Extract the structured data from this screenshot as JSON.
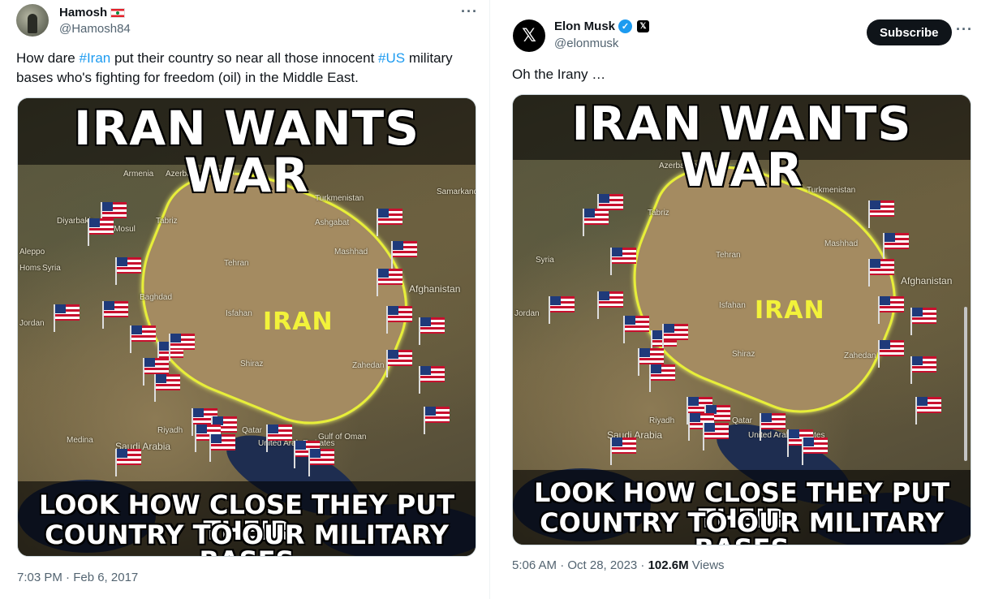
{
  "left_tweet": {
    "display_name": "Hamosh",
    "handle": "@Hamosh84",
    "text_part1": "How dare ",
    "hashtag1": "#Iran",
    "text_part2": " put their country so near all those innocent ",
    "hashtag2": "#US",
    "text_part3": " military bases who's fighting for freedom (oil) in the Middle East.",
    "timestamp": "7:03 PM · Feb 6, 2017",
    "more_label": "···"
  },
  "right_tweet": {
    "display_name": "Elon Musk",
    "handle": "@elonmusk",
    "avatar_glyph": "𝕏",
    "xbadge_glyph": "𝕏",
    "verified_glyph": "✓",
    "subscribe_label": "Subscribe",
    "text": "Oh the Irany …",
    "time": "5:06 AM · Oct 28, 2023 · ",
    "views_count": "102.6M",
    "views_label": " Views",
    "more_label": "···"
  },
  "meme": {
    "headline_top": "IRAN WANTS WAR",
    "headline_bottom_1": "LOOK HOW CLOSE THEY PUT THEIR",
    "headline_bottom_2": "COUNTRY TO OUR MILITARY BASES",
    "country_label": "IRAN",
    "places": [
      "Armenia",
      "Azerbaijan",
      "Baku",
      "Turkmenistan",
      "Samarkand",
      "Tabriz",
      "Ashgabat",
      "Mashhad",
      "Tehran",
      "Afghanistan",
      "Isfahan",
      "Shiraz",
      "Zahedan",
      "Baghdad",
      "Aleppo",
      "Syria",
      "Homs",
      "Jordan",
      "Riyadh",
      "Saudi Arabia",
      "Qatar",
      "United Arab Emirates",
      "Gulf of Oman",
      "Medina",
      "Diyarbakir",
      "Al-Mosul"
    ]
  },
  "colors": {
    "hashtag": "#1d9bf0",
    "verified": "#1d9bf0",
    "iran_border": "#e7ee39",
    "subscribe_bg": "#0f1419"
  }
}
